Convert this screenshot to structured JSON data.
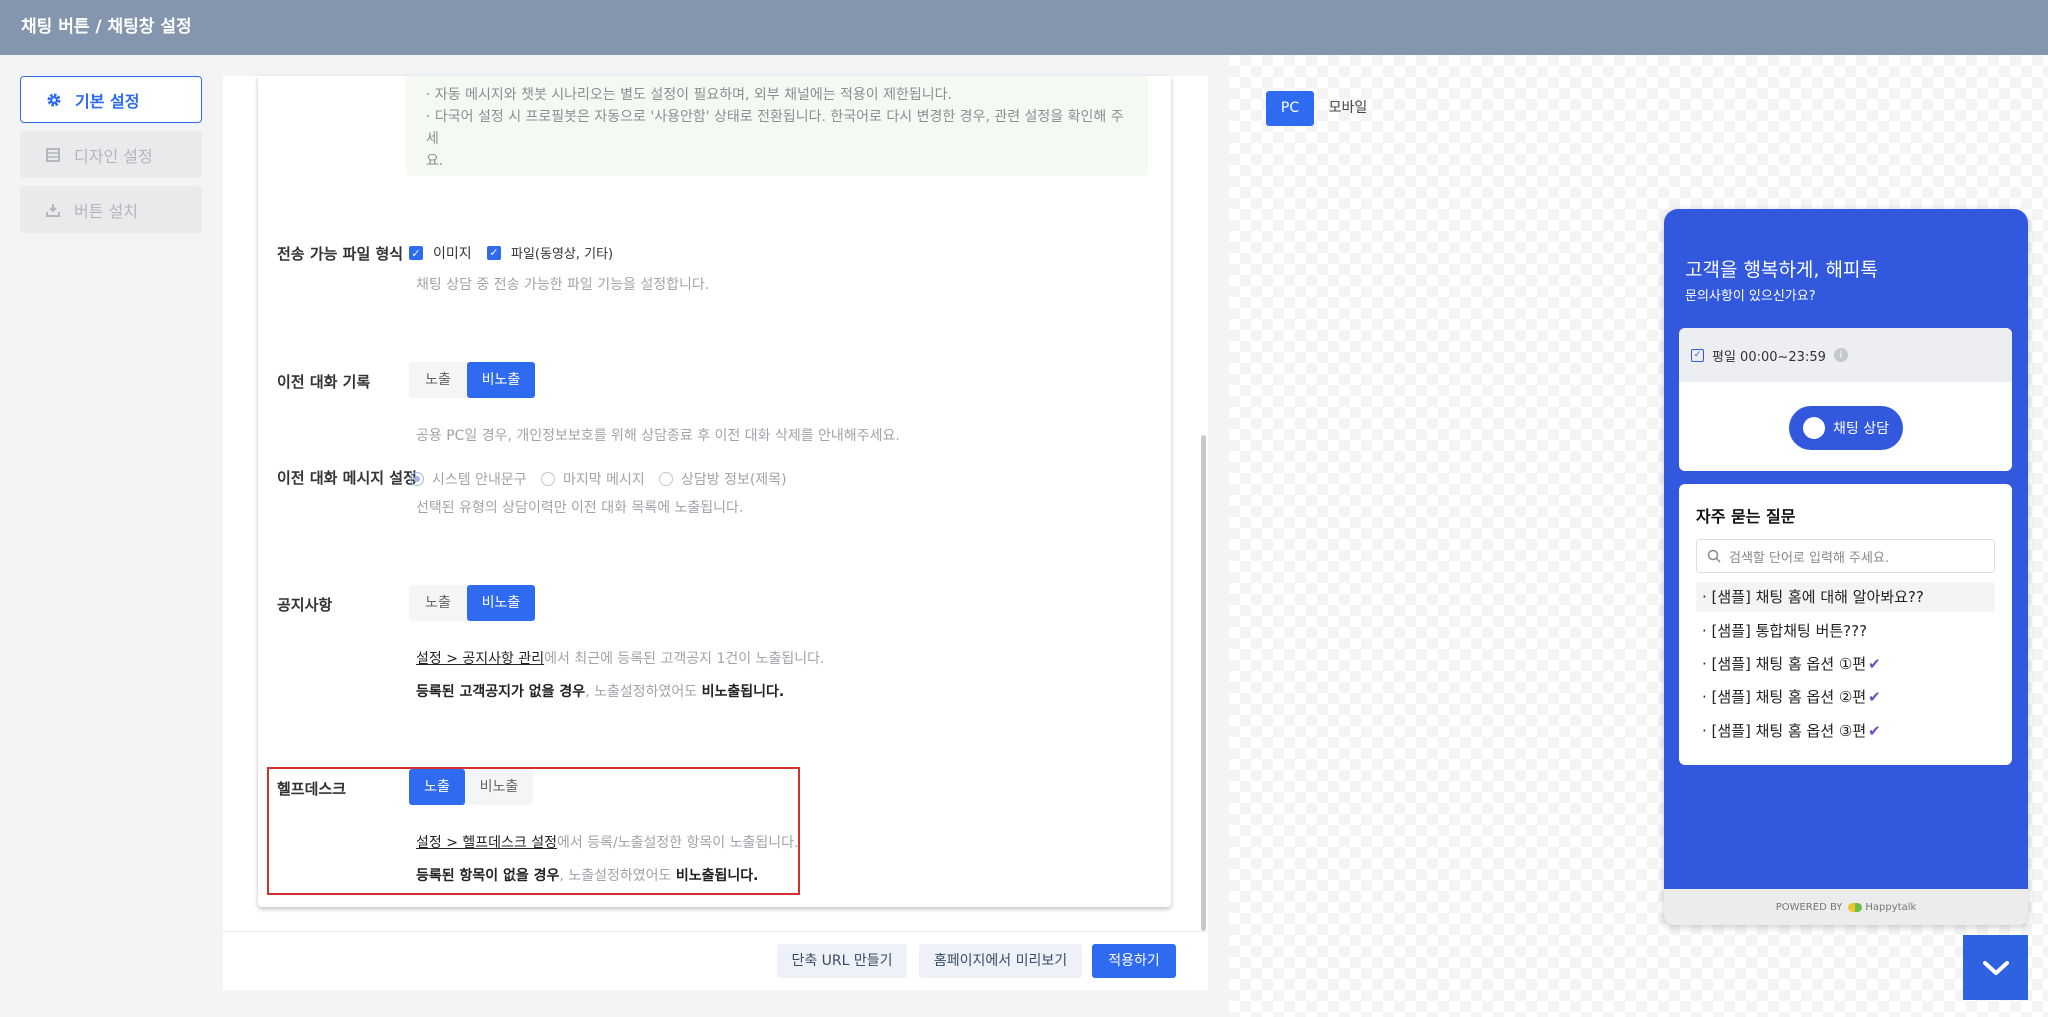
{
  "header": {
    "title": "채팅 버튼 / 채팅창 설정"
  },
  "sidebar": {
    "items": [
      {
        "label": "기본 설정",
        "icon": "gear-icon",
        "active": true
      },
      {
        "label": "디자인 설정",
        "icon": "layout-icon",
        "active": false
      },
      {
        "label": "버튼 설치",
        "icon": "download-icon",
        "active": false
      }
    ]
  },
  "notice": {
    "lines": [
      "· 자동 메시지와 챗봇 시나리오는 별도 설정이 필요하며, 외부 채널에는 적용이 제한됩니다.",
      "· 다국어 설정 시 프로필봇은 자동으로 '사용안함' 상태로 전환됩니다. 한국어로 다시 변경한 경우, 관련 설정을 확인해 주세",
      "요."
    ]
  },
  "file_types": {
    "label": "전송 가능 파일 형식",
    "options": [
      {
        "label": "이미지",
        "checked": true
      },
      {
        "label": "파일(동영상, 기타)",
        "checked": true
      }
    ],
    "desc": "채팅 상담 중 전송 가능한 파일 기능을 설정합니다."
  },
  "history": {
    "label": "이전 대화 기록",
    "show": "노출",
    "hide": "비노출",
    "selected": "비노출",
    "desc": "공용 PC일 경우, 개인정보보호를 위해 상담종료 후 이전 대화 삭제를 안내해주세요."
  },
  "history_msg": {
    "label": "이전 대화 메시지 설정",
    "options": [
      "시스템 안내문구",
      "마지막 메시지",
      "상담방 정보(제목)"
    ],
    "selected": "시스템 안내문구",
    "desc": "선택된 유형의 상담이력만 이전 대화 목록에 노출됩니다."
  },
  "notice_setting": {
    "label": "공지사항",
    "show": "노출",
    "hide": "비노출",
    "selected": "비노출",
    "desc1_link": "설정 > 공지사항 관리",
    "desc1_rest": "에서 최근에 등록된 고객공지 1건이 노출됩니다.",
    "desc2_a": "등록된 고객공지가 없을 경우",
    "desc2_b": ", 노출설정하였어도 ",
    "desc2_c": "비노출됩니다."
  },
  "helpdesk": {
    "label": "헬프데스크",
    "show": "노출",
    "hide": "비노출",
    "selected": "노출",
    "desc1_link": "설정 > 헬프데스크 설정",
    "desc1_rest": "에서 등록/노출설정한 항목이 노출됩니다.",
    "desc2_a": "등록된 항목이 없을 경우",
    "desc2_b": ", 노출설정하였어도 ",
    "desc2_c": "비노출됩니다."
  },
  "footer": {
    "short_url": "단축 URL 만들기",
    "preview": "홈페이지에서 미리보기",
    "apply": "적용하기"
  },
  "preview": {
    "tabs": [
      "PC",
      "모바일"
    ],
    "active_tab": "PC",
    "widget": {
      "title": "고객을 행복하게, 해피톡",
      "subtitle": "문의사항이 있으신가요?",
      "hours": "평일 00:00~23:59",
      "chat_button": "채팅 상담",
      "faq_title": "자주 묻는 질문",
      "search_placeholder": "검색할 단어로 입력해 주세요.",
      "faq": [
        "· [샘플] 채팅 홈에 대해 알아봐요??",
        "· [샘플] 통합채팅 버튼???",
        "· [샘플] 채팅 홈 옵션 ①편",
        "· [샘플] 채팅 홈 옵션 ②편",
        "· [샘플] 채팅 홈 옵션 ③편"
      ],
      "powered_by": "POWERED BY",
      "brand": "Happytalk"
    }
  },
  "colors": {
    "primary": "#2f6bf0",
    "header": "#8495ae",
    "widget": "#3258dd",
    "highlight": "#d32f2f"
  }
}
